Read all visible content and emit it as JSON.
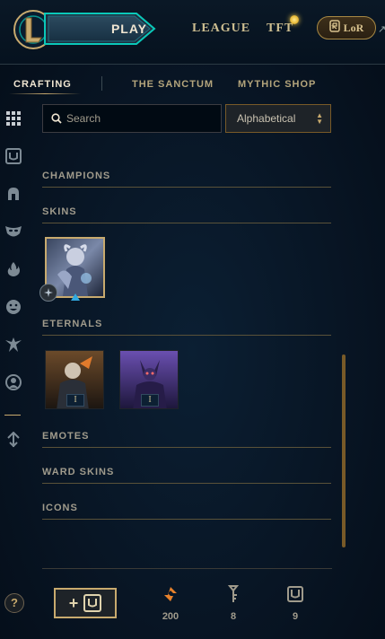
{
  "header": {
    "play_label": "PLAY",
    "nav": [
      "LEAGUE",
      "TFT"
    ],
    "lor_label": "LoR"
  },
  "subtabs": [
    "CRAFTING",
    "THE SANCTUM",
    "MYTHIC SHOP"
  ],
  "search": {
    "placeholder": "Search",
    "value": ""
  },
  "sort": {
    "selected": "Alphabetical"
  },
  "sections": {
    "champions": "CHAMPIONS",
    "skins": "SKINS",
    "eternals": "ETERNALS",
    "emotes": "EMOTES",
    "ward_skins": "WARD SKINS",
    "icons": "ICONS"
  },
  "eternal_tiles": [
    {
      "level": "I"
    },
    {
      "level": "I"
    }
  ],
  "currencies": [
    {
      "name": "orange-essence-icon",
      "value": "200"
    },
    {
      "name": "key-icon",
      "value": "8"
    },
    {
      "name": "chest-icon",
      "value": "9"
    }
  ],
  "colors": {
    "gold": "#c8aa6e",
    "accent_blue": "#31a9e0",
    "notification": "#f5cc4b"
  }
}
